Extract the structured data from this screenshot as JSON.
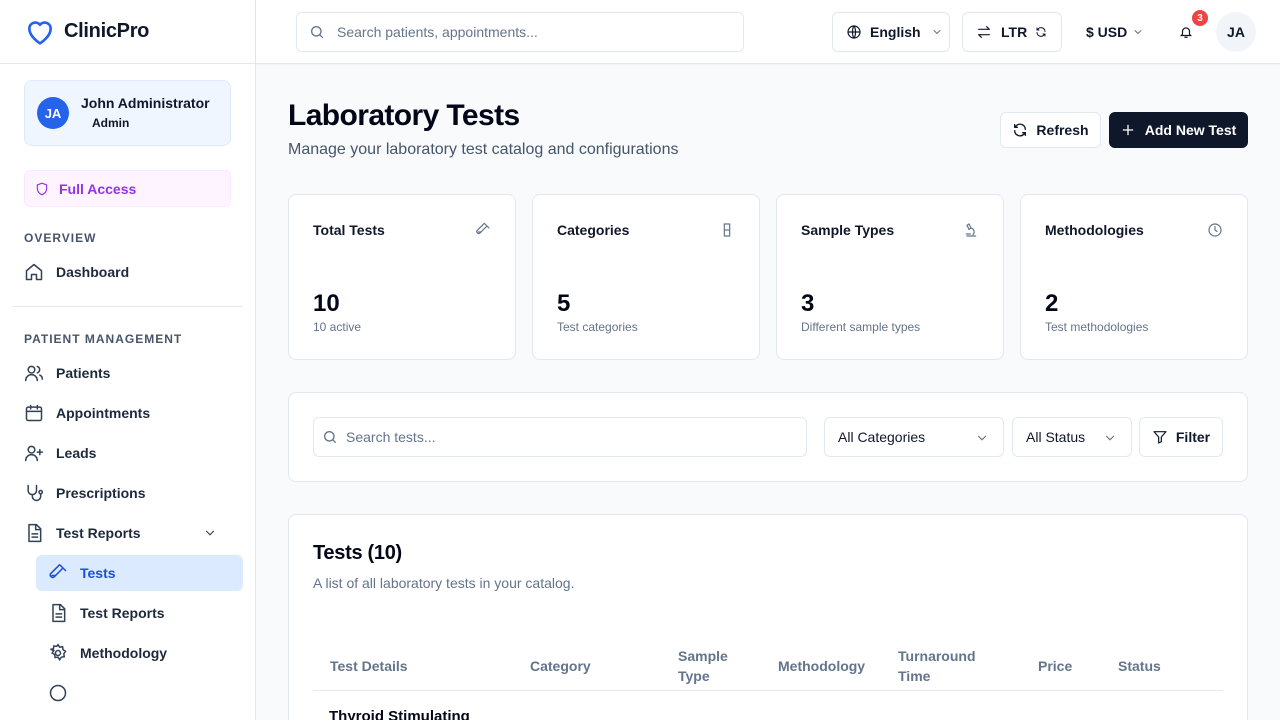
{
  "brand": {
    "name": "ClinicPro"
  },
  "user": {
    "initials": "JA",
    "name": "John Administrator",
    "role": "Admin"
  },
  "access": {
    "label": "Full Access"
  },
  "sidebar": {
    "sections": [
      {
        "label": "OVERVIEW"
      },
      {
        "label": "PATIENT MANAGEMENT"
      }
    ],
    "items": [
      {
        "label": "Dashboard",
        "icon": "home-icon"
      },
      {
        "label": "Patients",
        "icon": "users-icon"
      },
      {
        "label": "Appointments",
        "icon": "calendar-icon"
      },
      {
        "label": "Leads",
        "icon": "user-plus-icon"
      },
      {
        "label": "Prescriptions",
        "icon": "stethoscope-icon"
      },
      {
        "label": "Test Reports",
        "icon": "file-text-icon",
        "expanded": true
      }
    ],
    "sub_items": [
      {
        "label": "Tests",
        "icon": "test-tube-icon",
        "active": true
      },
      {
        "label": "Test Reports",
        "icon": "file-text-icon"
      },
      {
        "label": "Methodology",
        "icon": "gear-icon"
      }
    ]
  },
  "header": {
    "search_placeholder": "Search patients, appointments...",
    "language": "English",
    "direction": "LTR",
    "currency": "$ USD",
    "notification_count": "3",
    "avatar_initials": "JA"
  },
  "page": {
    "title": "Laboratory Tests",
    "subtitle": "Manage your laboratory test catalog and configurations",
    "refresh_label": "Refresh",
    "add_label": "Add New Test"
  },
  "stats": [
    {
      "title": "Total Tests",
      "value": "10",
      "sub": "10 active",
      "icon": "test-tube-icon"
    },
    {
      "title": "Categories",
      "value": "5",
      "sub": "Test categories",
      "icon": "flask-icon"
    },
    {
      "title": "Sample Types",
      "value": "3",
      "sub": "Different sample types",
      "icon": "microscope-icon"
    },
    {
      "title": "Methodologies",
      "value": "2",
      "sub": "Test methodologies",
      "icon": "clock-icon"
    }
  ],
  "filters": {
    "search_placeholder": "Search tests...",
    "category": "All Categories",
    "status": "All Status",
    "filter_label": "Filter"
  },
  "table": {
    "title": "Tests (10)",
    "description": "A list of all laboratory tests in your catalog.",
    "columns": [
      {
        "label": "Test Details"
      },
      {
        "label": "Category"
      },
      {
        "label": "Sample\nType"
      },
      {
        "label": "Methodology"
      },
      {
        "label": "Turnaround\nTime"
      },
      {
        "label": "Price"
      },
      {
        "label": "Status"
      }
    ],
    "first_row_name": "Thyroid Stimulating"
  },
  "colors": {
    "primary": "#2563eb",
    "dark_button": "#0f172a",
    "active_nav_bg": "#dbeafe",
    "access_purple": "#9333ea",
    "badge_red": "#ef4444"
  }
}
